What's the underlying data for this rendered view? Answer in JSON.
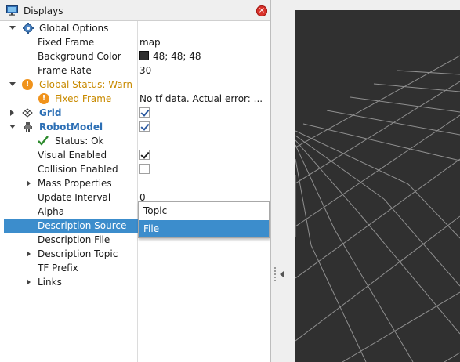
{
  "panel": {
    "title": "Displays",
    "close_label": "×"
  },
  "tree": {
    "global_options": "Global Options",
    "fixed_frame_label": "Fixed Frame",
    "fixed_frame_value": "map",
    "background_color_label": "Background Color",
    "background_color_value": "48; 48; 48",
    "frame_rate_label": "Frame Rate",
    "frame_rate_value": "30",
    "global_status": "Global Status: Warn",
    "status_fixed_frame_label": "Fixed Frame",
    "status_fixed_frame_value": "No tf data.  Actual error: ...",
    "grid": "Grid",
    "robot_model": "RobotModel",
    "status_ok": "Status: Ok",
    "visual_enabled": "Visual Enabled",
    "collision_enabled": "Collision Enabled",
    "mass_properties": "Mass Properties",
    "update_interval_label": "Update Interval",
    "update_interval_value": "0",
    "alpha": "Alpha",
    "description_source": "Description Source",
    "description_file": "Description File",
    "description_topic": "Description Topic",
    "tf_prefix": "TF Prefix",
    "links": "Links"
  },
  "checks": {
    "grid": true,
    "robot_model": true,
    "visual_enabled": true,
    "collision_enabled": false
  },
  "dropdown": {
    "options": [
      "Topic",
      "File"
    ],
    "selected": "File"
  },
  "colors": {
    "selection": "#3c8dcc",
    "warn": "#c88a00",
    "link": "#2c6fb5",
    "background": "#303030",
    "ok_check": "#2e8b2e"
  }
}
